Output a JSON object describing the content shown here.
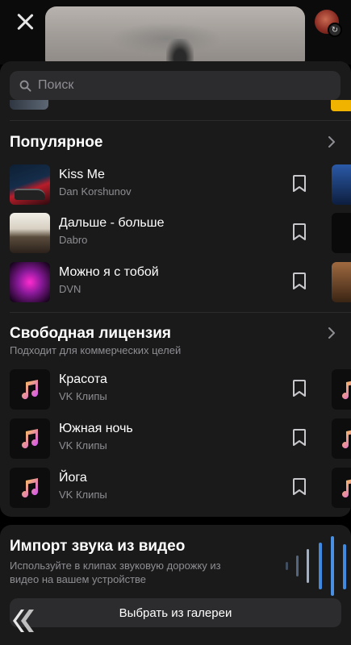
{
  "search": {
    "placeholder": "Поиск"
  },
  "popular": {
    "title": "Популярное",
    "tracks": [
      {
        "title": "Kiss Me",
        "artist": "Dan Korshunov"
      },
      {
        "title": "Дальше - больше",
        "artist": "Dabro"
      },
      {
        "title": "Можно я с тобой",
        "artist": "DVN"
      }
    ]
  },
  "free": {
    "title": "Свободная лицензия",
    "subtitle": "Подходит для коммерческих целей",
    "tracks": [
      {
        "title": "Красота",
        "artist": "VK Клипы"
      },
      {
        "title": "Южная ночь",
        "artist": "VK Клипы"
      },
      {
        "title": "Йога",
        "artist": "VK Клипы"
      }
    ]
  },
  "import": {
    "title": "Импорт звука из видео",
    "description": "Используйте в клипах звуковую дорожку из видео на вашем устройстве",
    "button_label": "Выбрать из галереи"
  },
  "colors": {
    "accent": "#3f8ae0",
    "sheet": "#1a1a1a",
    "field": "#2c2c2e",
    "secondary_text": "#8e8e93"
  },
  "icons": [
    "close-icon",
    "avatar",
    "refresh-icon",
    "search-icon",
    "chevron-right-icon",
    "bookmark-icon",
    "music-note-icon",
    "sound-wave-icon"
  ]
}
